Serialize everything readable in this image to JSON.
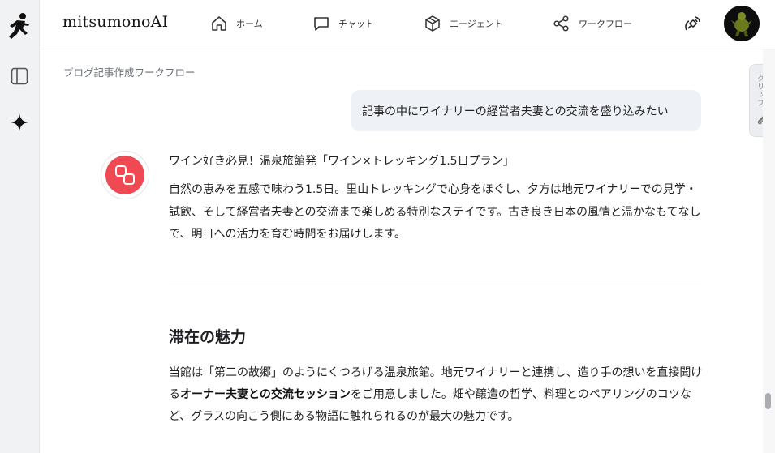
{
  "header": {
    "brand": "mitsumonoAI",
    "nav": [
      {
        "label": "ホーム",
        "icon": "home-icon"
      },
      {
        "label": "チャット",
        "icon": "chat-icon"
      },
      {
        "label": "エージェント",
        "icon": "cube-icon"
      },
      {
        "label": "ワークフロー",
        "icon": "share-nodes-icon"
      }
    ]
  },
  "breadcrumb": "ブログ記事作成ワークフロー",
  "user_message": "記事の中にワイナリーの経営者夫妻との交流を盛り込みたい",
  "reply": {
    "title": "ワイン好き必見！温泉旅館発「ワイン×トレッキング1.5日プラン」",
    "intro": "自然の恵みを五感で味わう1.5日。里山トレッキングで心身をほぐし、夕方は地元ワイナリーでの見学・試飲、そして経営者夫妻との交流まで楽しめる特別なステイです。古き良き日本の風情と温かなもてなしで、明日への活力を育む時間をお届けします。",
    "section_heading": "滞在の魅力",
    "section_body_1": "当館は「第二の故郷」のようにくつろげる温泉旅館。地元ワイナリーと連携し、造り手の想いを直接聞ける",
    "section_body_bold": "オーナー夫妻との交流セッション",
    "section_body_2": "をご用意しました。畑や醸造の哲学、料理とのペアリングのコツなど、グラスの向こう側にある物語に触れられるのが最大の魅力です。"
  },
  "clip_tab": {
    "label": "クリップ"
  },
  "colors": {
    "bot_avatar": "#ef4a54",
    "user_bubble": "#eef1f6",
    "rail": "#f1f2f4"
  }
}
